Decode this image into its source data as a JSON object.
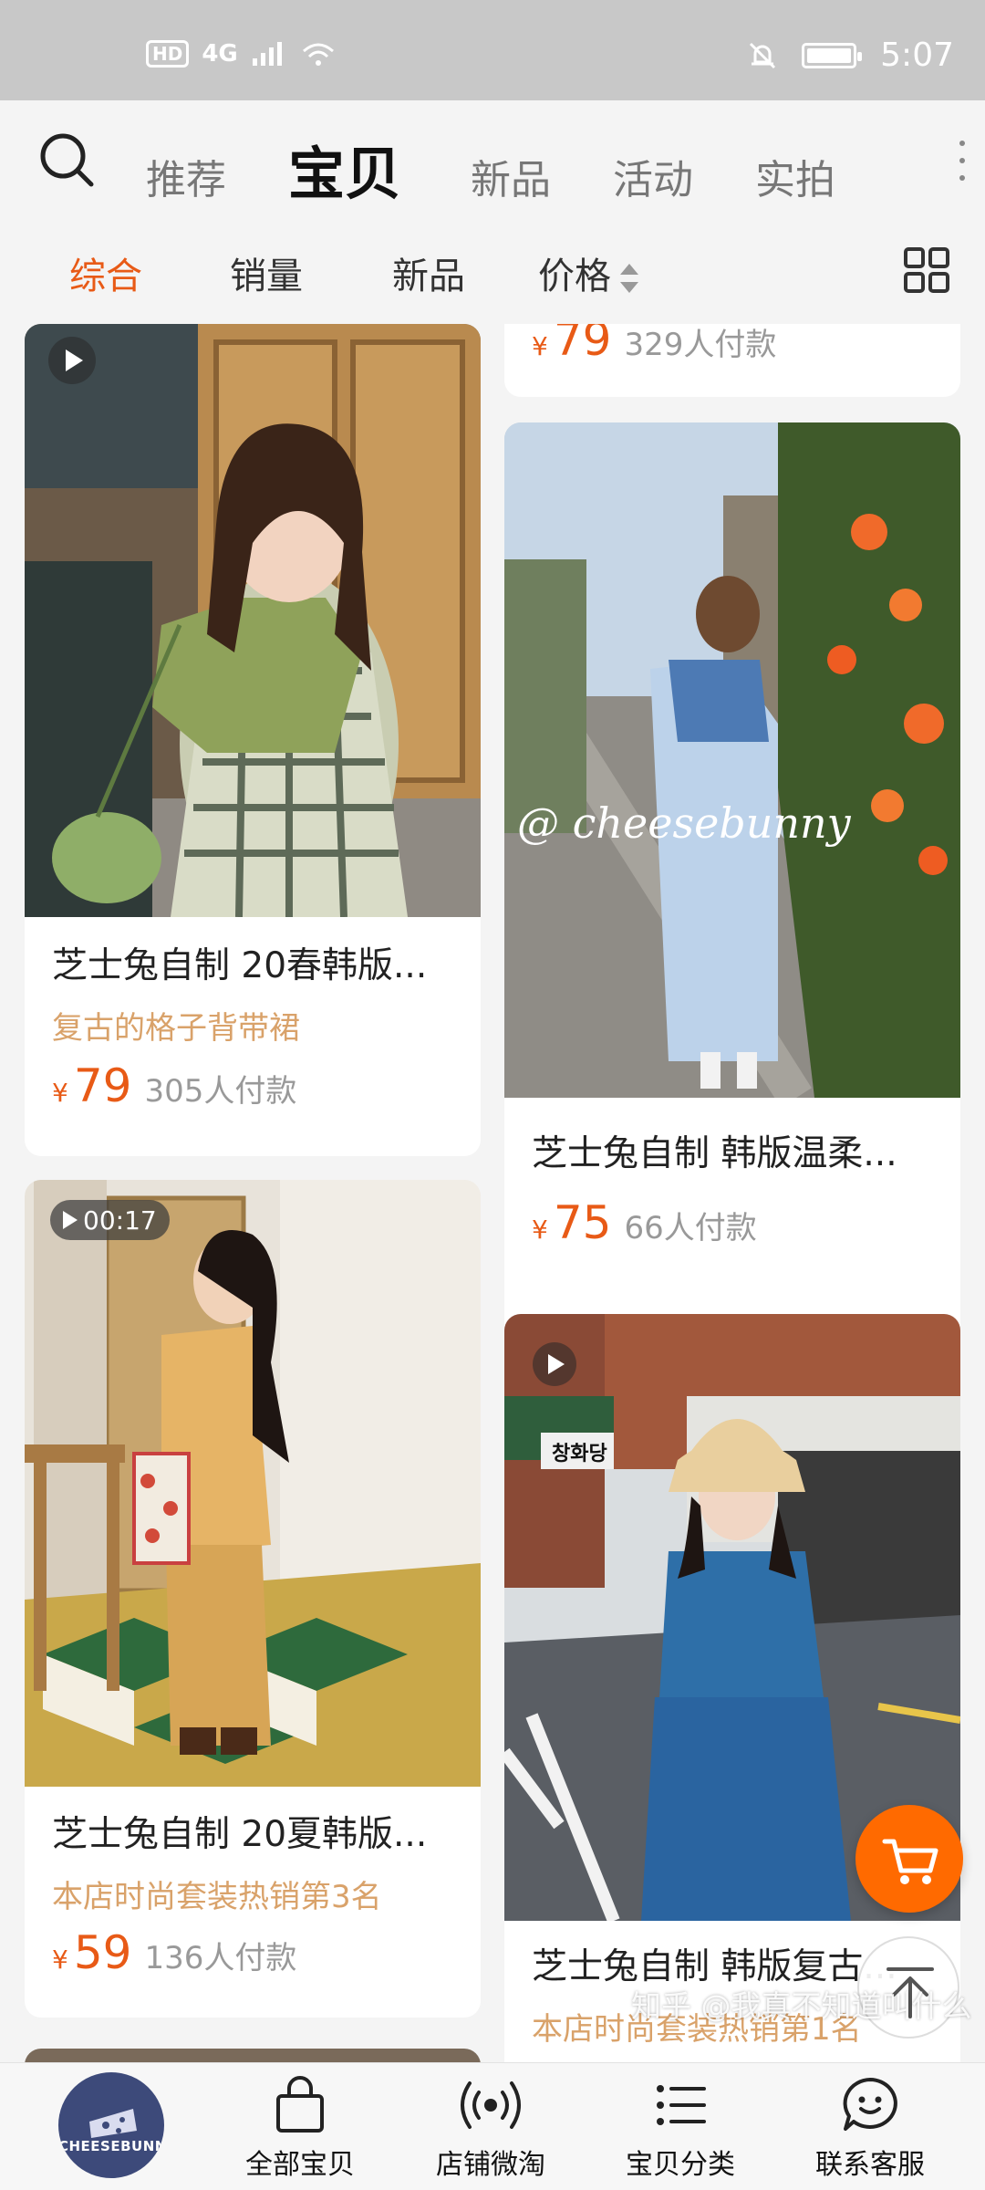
{
  "status_bar": {
    "network": "4G",
    "hd": "HD",
    "time": "5:07"
  },
  "nav": {
    "tabs": [
      {
        "label": "推荐",
        "active": false
      },
      {
        "label": "宝贝",
        "active": true
      },
      {
        "label": "新品",
        "active": false
      },
      {
        "label": "活动",
        "active": false
      },
      {
        "label": "实拍",
        "active": false
      }
    ]
  },
  "sort": {
    "items": [
      {
        "label": "综合",
        "active": true
      },
      {
        "label": "销量",
        "active": false
      },
      {
        "label": "新品",
        "active": false
      },
      {
        "label": "价格",
        "active": false
      }
    ]
  },
  "products": {
    "partial_top": {
      "price": "79",
      "sold": "329人付款"
    },
    "p1": {
      "title": "芝士兔自制 20春韩版...",
      "subtitle": "复古的格子背带裙",
      "price": "79",
      "sold": "305人付款"
    },
    "p2": {
      "title": "芝士兔自制 韩版温柔...",
      "price": "75",
      "sold": "66人付款",
      "image_text": "@ cheesebunny"
    },
    "p3": {
      "title": "芝士兔自制 20夏韩版...",
      "subtitle": "本店时尚套装热销第3名",
      "price": "59",
      "sold": "136人付款",
      "video_duration": "00:17"
    },
    "p4": {
      "title": "芝士兔自制 韩版复古...",
      "subtitle": "本店时尚套装热销第1名",
      "shop_sign": "창화당"
    },
    "currency": "¥"
  },
  "bottom_nav": {
    "logo_text": "CHEESEBUNNY",
    "items": [
      {
        "label": "全部宝贝",
        "icon": "shopping-bag-icon"
      },
      {
        "label": "店铺微淘",
        "icon": "broadcast-icon"
      },
      {
        "label": "宝贝分类",
        "icon": "list-icon"
      },
      {
        "label": "联系客服",
        "icon": "chat-face-icon"
      }
    ]
  },
  "watermark": "知乎 @我真不知道叫什么",
  "colors": {
    "accent": "#e85a16",
    "subtitle": "#d9a26a",
    "cart": "#ff6a00"
  }
}
